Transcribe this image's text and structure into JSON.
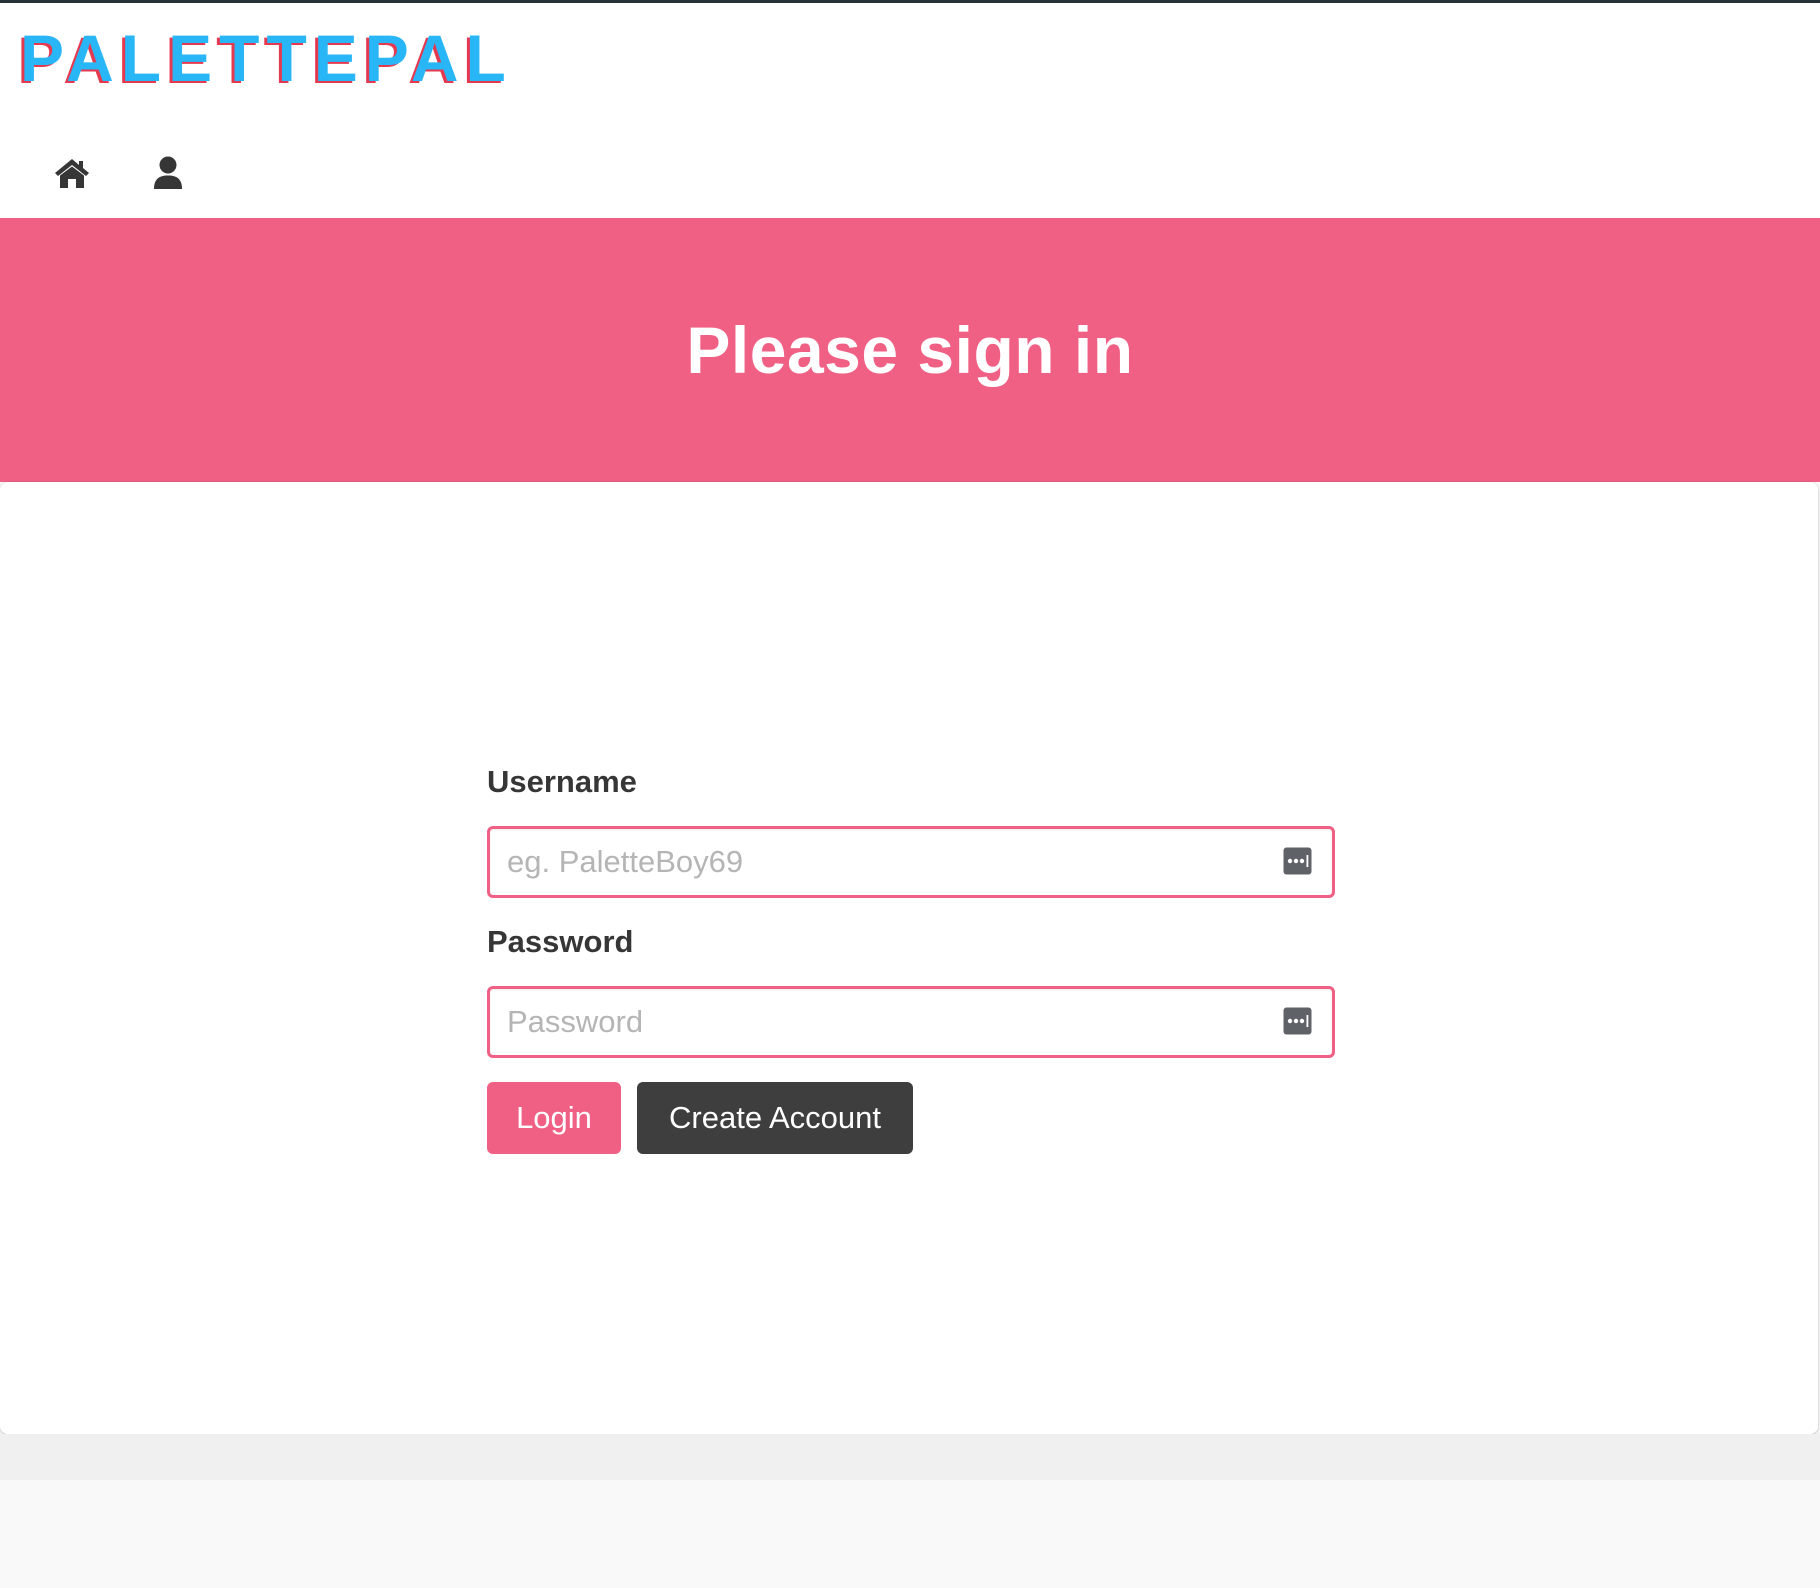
{
  "app": {
    "logo_text": "PALETTEPAL"
  },
  "nav": {
    "items": [
      {
        "icon": "home-icon",
        "label": "Home"
      },
      {
        "icon": "user-icon",
        "label": "Account"
      }
    ]
  },
  "hero": {
    "title": "Please sign in"
  },
  "login_form": {
    "username_label": "Username",
    "username_placeholder": "eg. PaletteBoy69",
    "username_value": "",
    "password_label": "Password",
    "password_placeholder": "Password",
    "password_value": "",
    "login_button": "Login",
    "create_account_button": "Create Account"
  },
  "colors": {
    "accent_pink": "#f06085",
    "logo_blue": "#29b6f6",
    "logo_red_shadow": "#e53950",
    "dark_button": "#3e3e3e",
    "text_dark": "#363636",
    "placeholder_gray": "#b5b5b5"
  }
}
